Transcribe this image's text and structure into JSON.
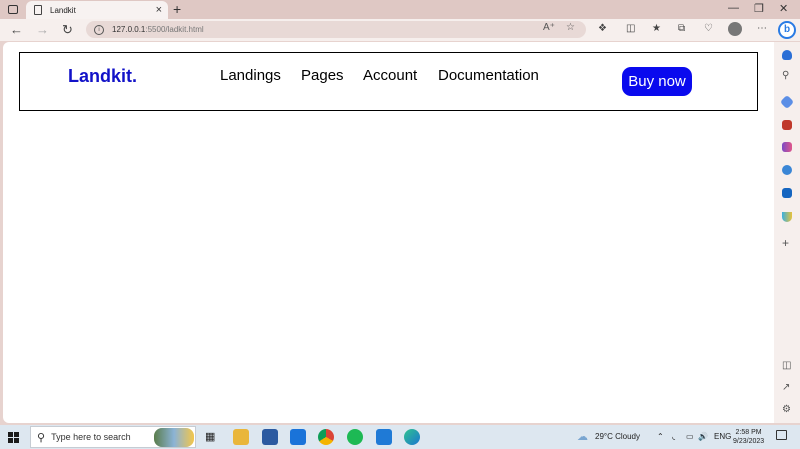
{
  "browser": {
    "tab_title": "Landkit",
    "url_host": "127.0.0.1",
    "url_path": ":5500/ladkit.html",
    "new_tab_symbol": "+",
    "close_symbol": "×"
  },
  "page": {
    "brand": "Landkit.",
    "nav_links": [
      "Landings",
      "Pages",
      "Account",
      "Documentation"
    ],
    "cta": "Buy now",
    "brand_color": "#1212c8",
    "cta_color": "#0a0aee"
  },
  "taskbar": {
    "search_placeholder": "Type here to search",
    "weather": "29°C  Cloudy",
    "language": "ENG",
    "time": "2:58 PM",
    "date": "9/23/2023"
  }
}
